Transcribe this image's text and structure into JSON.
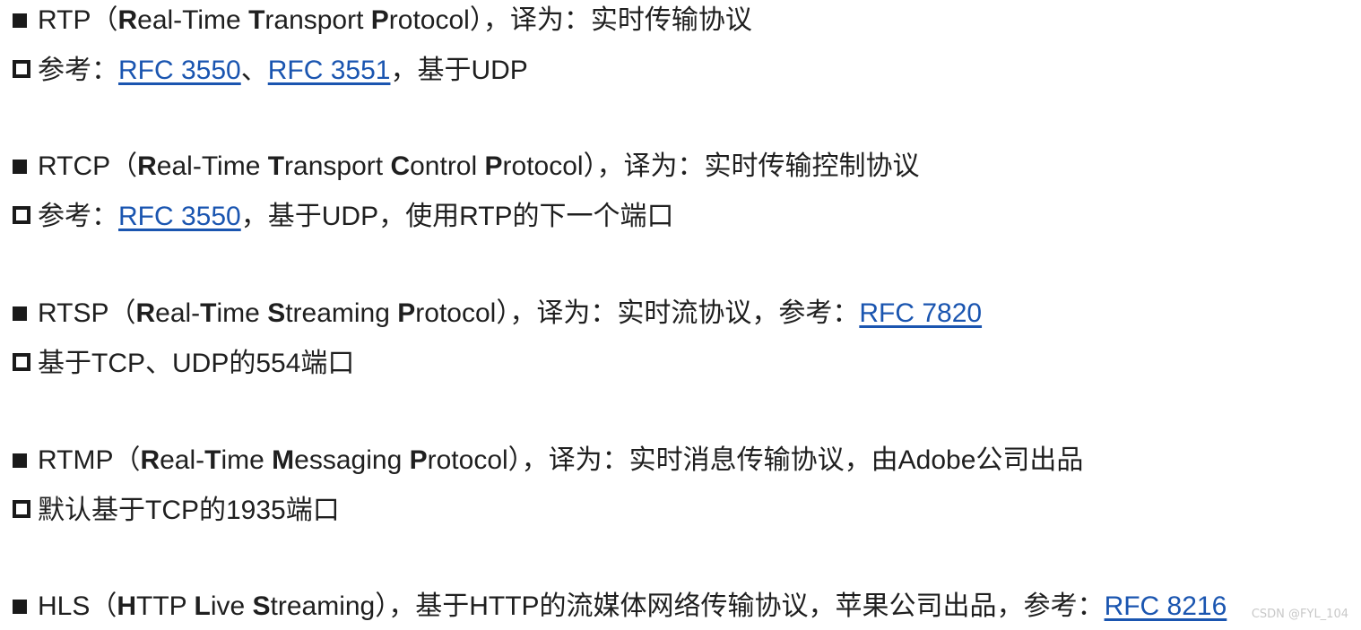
{
  "colors": {
    "link": "#1a55b0",
    "text": "#1f1f1f",
    "bullet": "#1a1a1a"
  },
  "rtp": {
    "title_prefix": "RTP（",
    "w1_initial": "R",
    "w1_rest": "eal-Time ",
    "w2_initial": "T",
    "w2_rest": "ransport ",
    "w3_initial": "P",
    "w3_rest": "rotocol",
    "title_suffix": "），译为：实时传输协议",
    "ref_label": "参考：",
    "link1": "RFC 3550",
    "sep": "、",
    "link2": "RFC 3551",
    "ref_tail": "，基于UDP"
  },
  "rtcp": {
    "title_prefix": "RTCP（",
    "w1_initial": "R",
    "w1_rest": "eal-Time ",
    "w2_initial": "T",
    "w2_rest": "ransport ",
    "w3_initial": "C",
    "w3_rest": "ontrol ",
    "w4_initial": "P",
    "w4_rest": "rotocol",
    "title_suffix": "），译为：实时传输控制协议",
    "ref_label": "参考：",
    "link1": "RFC 3550",
    "ref_tail": "，基于UDP，使用RTP的下一个端口"
  },
  "rtsp": {
    "title_prefix": "RTSP（",
    "w1_initial": "R",
    "w1_rest": "eal-",
    "w2_initial": "T",
    "w2_rest": "ime ",
    "w3_initial": "S",
    "w3_rest": "treaming ",
    "w4_initial": "P",
    "w4_rest": "rotocol",
    "title_suffix": "），译为：实时流协议，参考：",
    "link1": "RFC 7820",
    "sub": "基于TCP、UDP的554端口"
  },
  "rtmp": {
    "title_prefix": "RTMP（",
    "w1_initial": "R",
    "w1_rest": "eal-",
    "w2_initial": "T",
    "w2_rest": "ime ",
    "w3_initial": "M",
    "w3_rest": "essaging ",
    "w4_initial": "P",
    "w4_rest": "rotocol",
    "title_suffix": "），译为：实时消息传输协议，由Adobe公司出品",
    "sub": "默认基于TCP的1935端口"
  },
  "hls": {
    "title_prefix": "HLS（",
    "w1_initial": "H",
    "w1_rest": "TTP ",
    "w2_initial": "L",
    "w2_rest": "ive ",
    "w3_initial": "S",
    "w3_rest": "treaming",
    "title_suffix": "），基于HTTP的流媒体网络传输协议，苹果公司出品，参考：",
    "link1": "RFC 8216"
  },
  "watermark": "CSDN @FYL_104"
}
